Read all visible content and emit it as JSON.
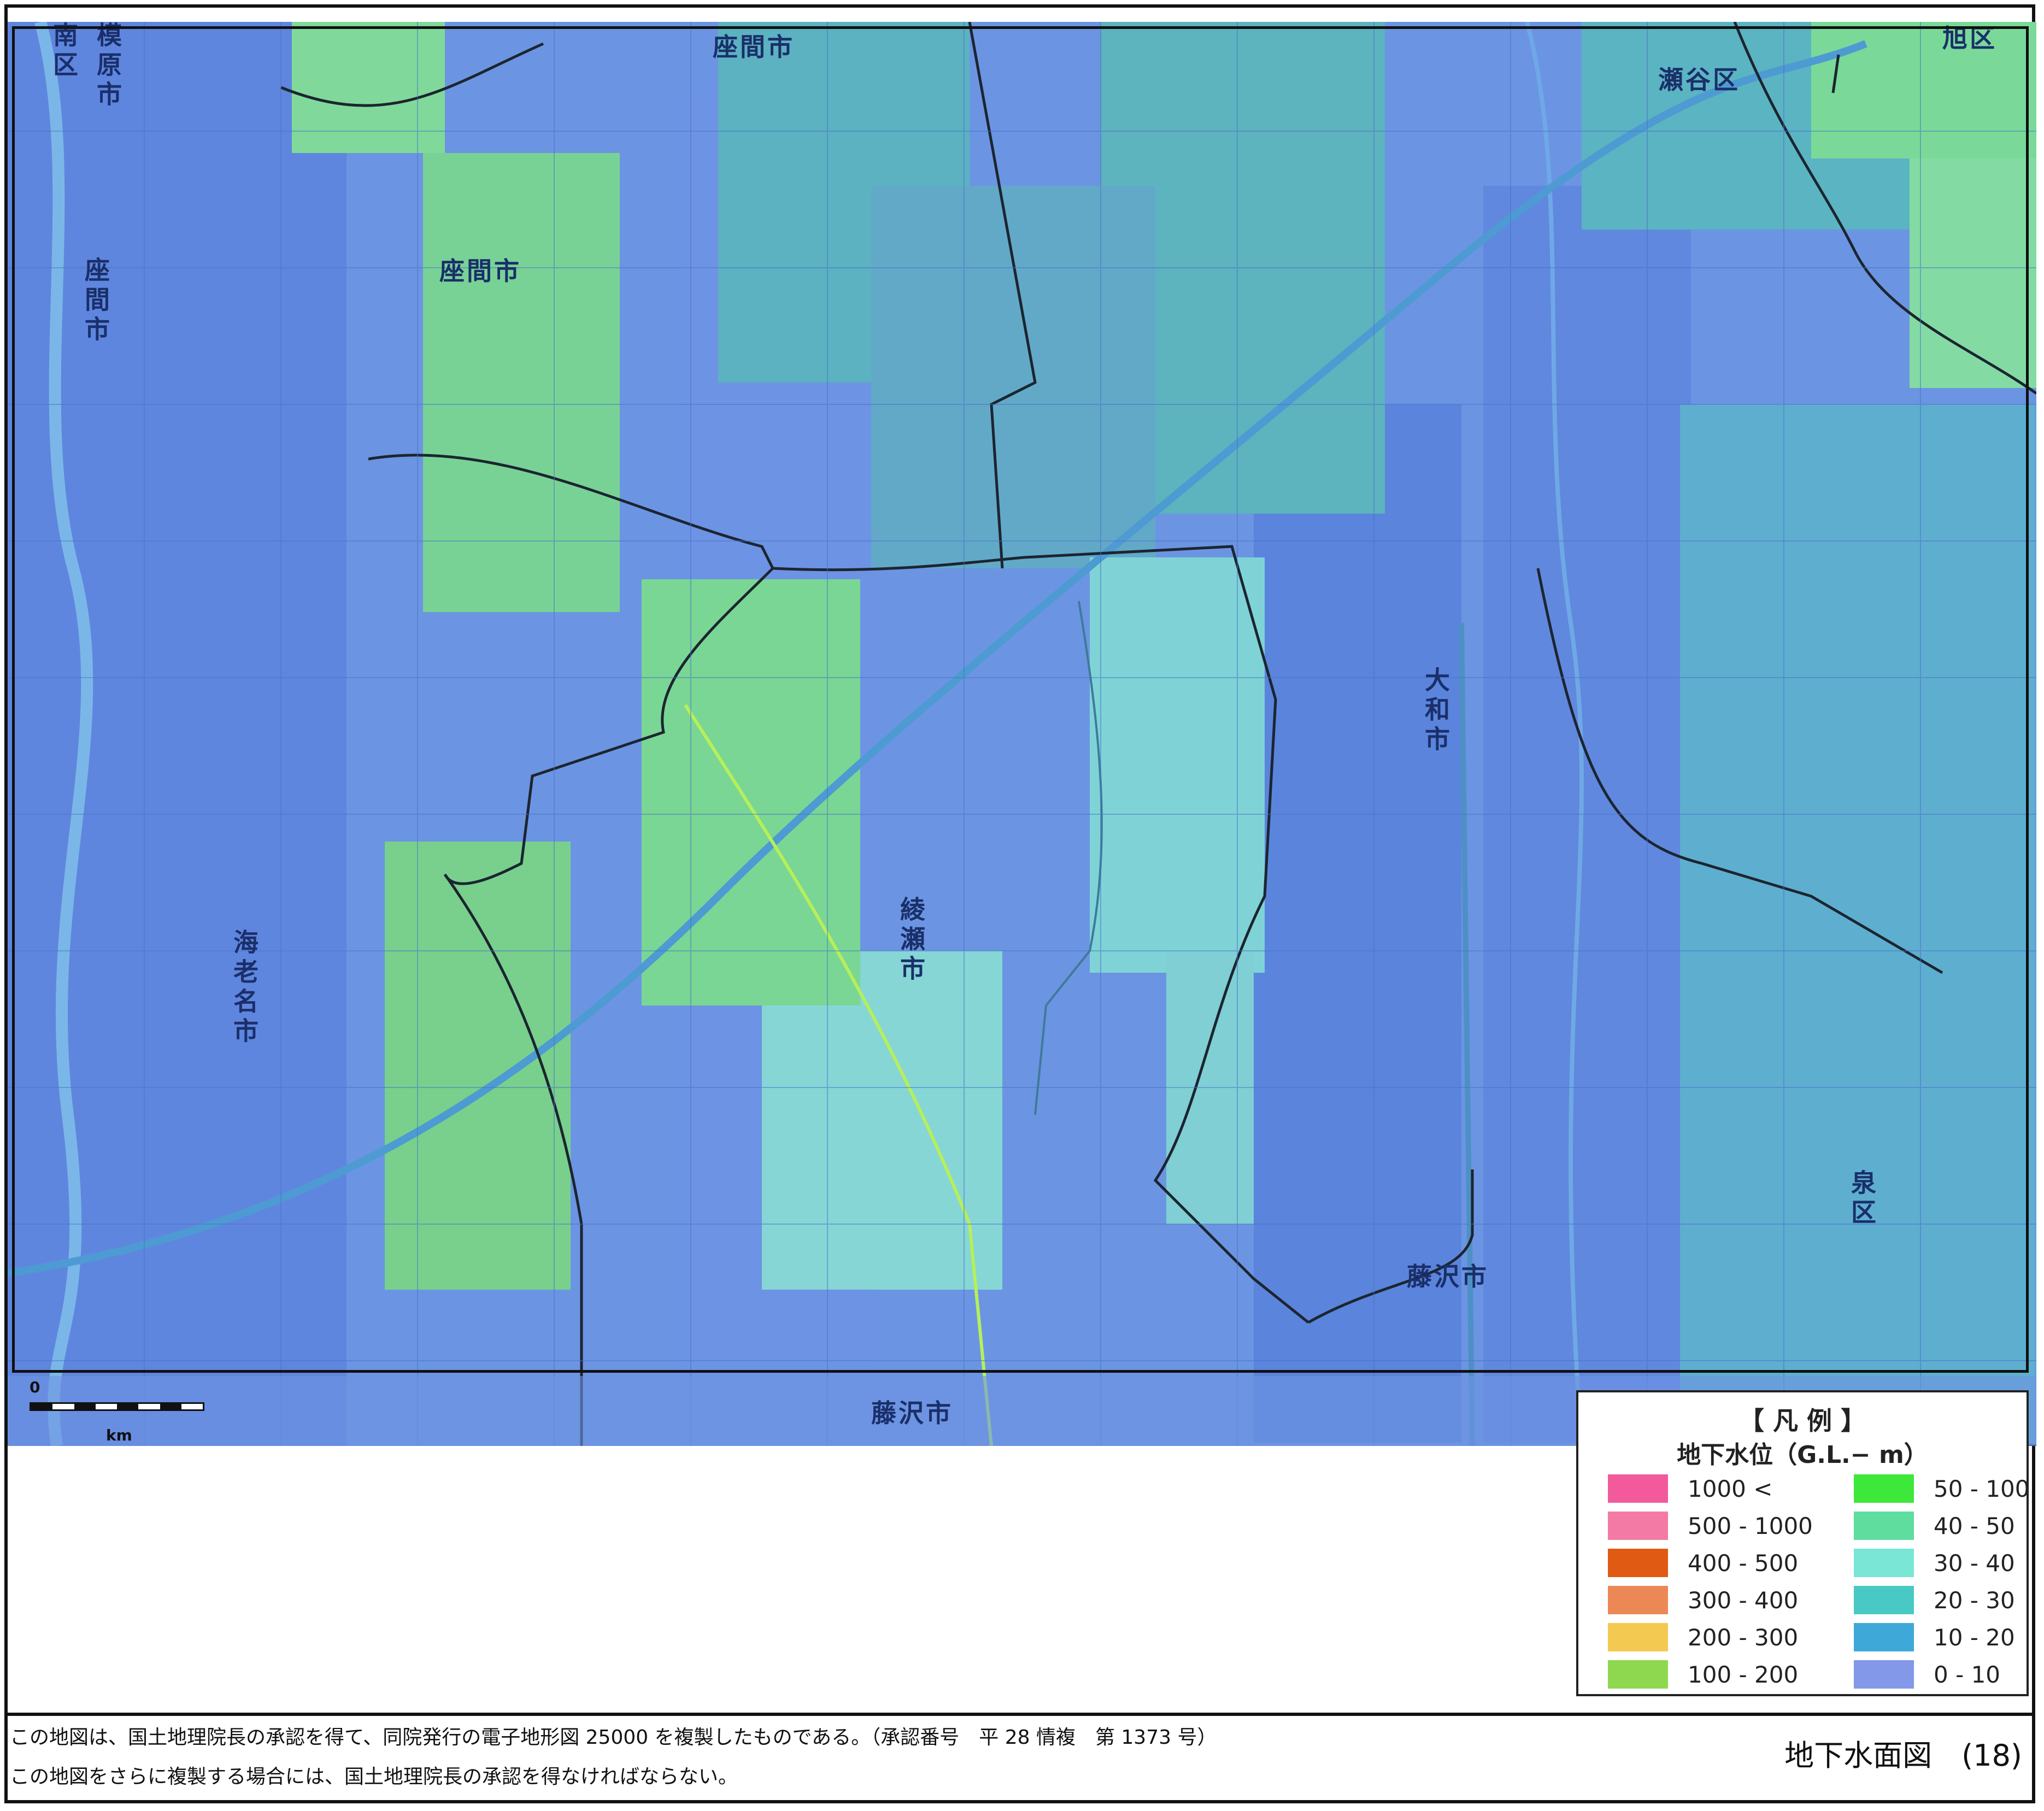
{
  "legend": {
    "title": "【 凡 例 】",
    "subtitle": "地下水位（G.L.− m）",
    "left_items": [
      {
        "label": "1000 <",
        "color": "#f25a9c"
      },
      {
        "label": "500 - 1000",
        "color": "#f47aa6"
      },
      {
        "label": "400 - 500",
        "color": "#e15a14"
      },
      {
        "label": "300 - 400",
        "color": "#ec8856"
      },
      {
        "label": "200 - 300",
        "color": "#f4c952"
      },
      {
        "label": "100 - 200",
        "color": "#8ed84f"
      }
    ],
    "right_items": [
      {
        "label": "50 - 100",
        "color": "#3ee83a"
      },
      {
        "label": "40 - 50",
        "color": "#5edd9e"
      },
      {
        "label": "30 - 40",
        "color": "#79e6d6"
      },
      {
        "label": "20 - 30",
        "color": "#49c9c3"
      },
      {
        "label": "10 - 20",
        "color": "#3ea9d8"
      },
      {
        "label": "0 - 10",
        "color": "#8398e8"
      }
    ]
  },
  "places": {
    "minami_ku": "南区",
    "sagamihara": "模原市",
    "zama_top": "座間市",
    "zama_left": "座間市",
    "zama_mid": "座間市",
    "seya_ku": "瀬谷区",
    "ebina": "海老名市",
    "ayase": "綾瀬市",
    "yamato": "大和市",
    "fujisawa_mid": "藤沢市",
    "fujisawa_bottom": "藤沢市",
    "izumi_ku": "泉区",
    "asahi_ku": "旭区"
  },
  "scale": {
    "zero": "0",
    "unit": "km"
  },
  "notes": {
    "line1": "この地図は、国土地理院長の承認を得て、同院発行の電子地形図 25000 を複製したものである。（承認番号　平 28 情複　第 1373 号）",
    "line2": "この地図をさらに複製する場合には、国土地理院長の承認を得なければならない。"
  },
  "caption": "地下水面図　(18)"
}
